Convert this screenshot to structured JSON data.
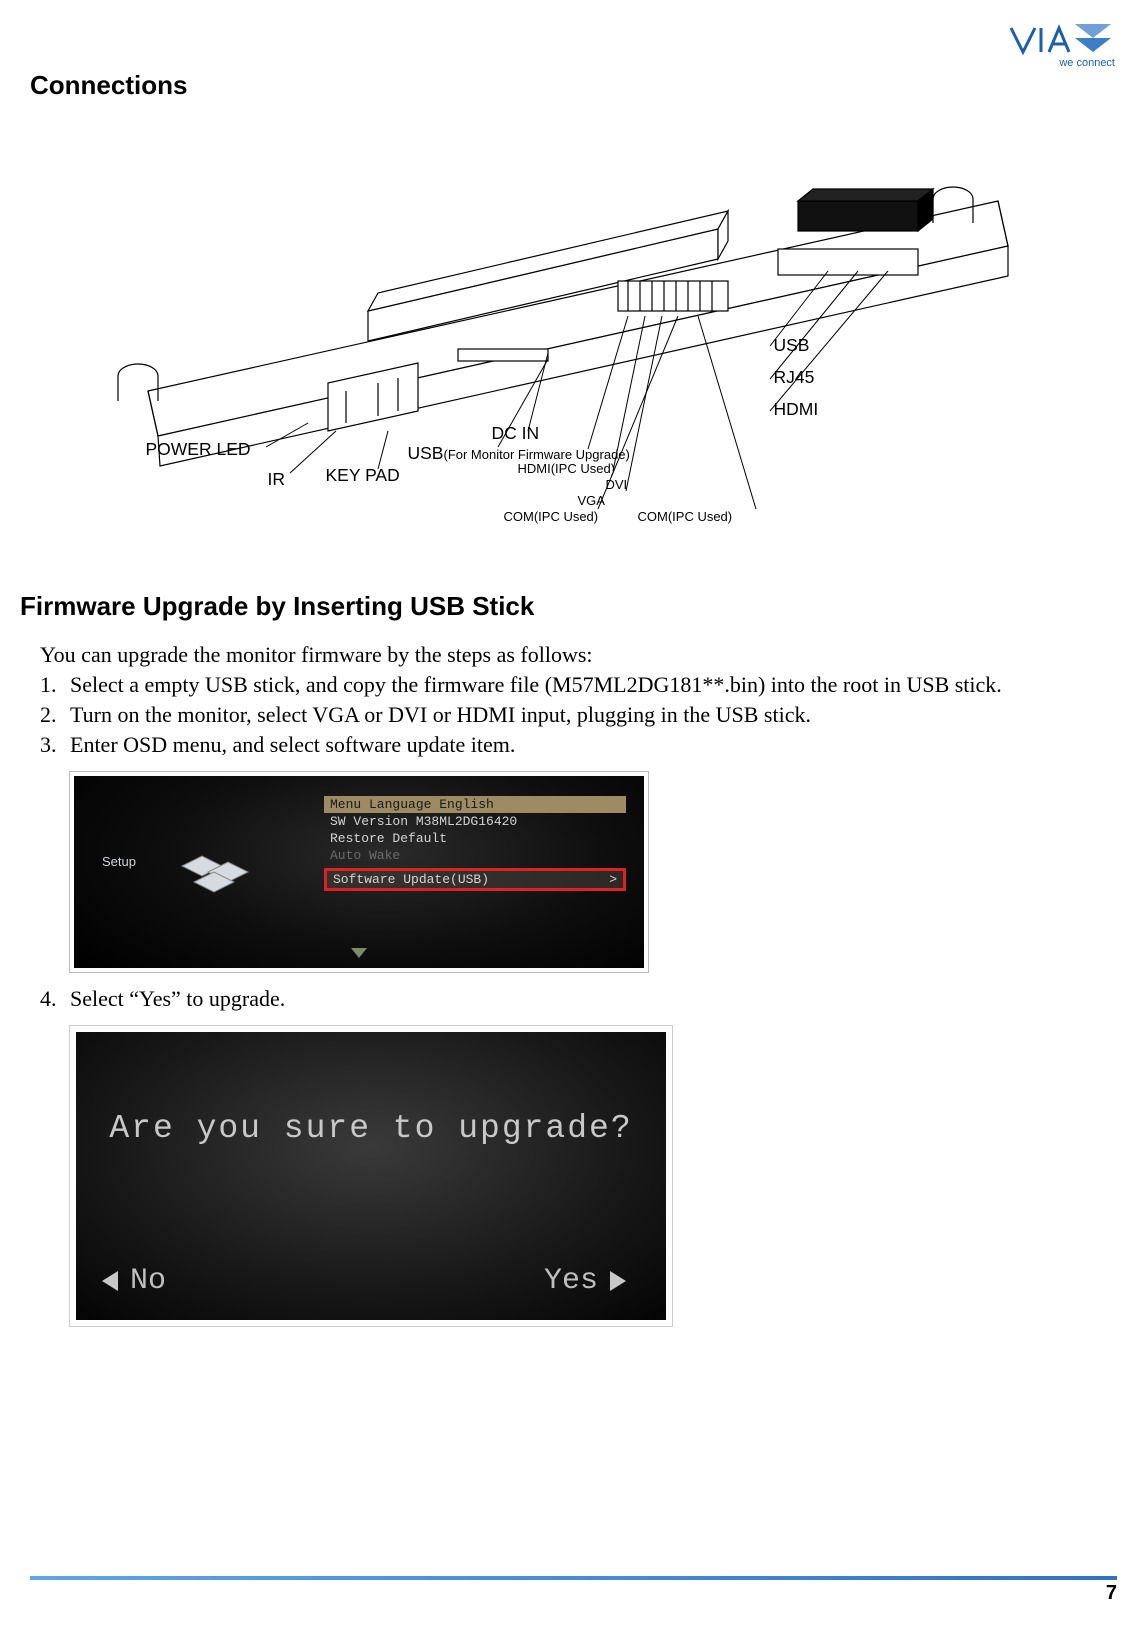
{
  "brand": {
    "name": "VIA",
    "tagline": "we connect"
  },
  "headings": {
    "connections": "Connections",
    "firmware": "Firmware Upgrade by Inserting USB Stick"
  },
  "connections_labels": {
    "power_led": "POWER LED",
    "ir": "IR",
    "key_pad": "KEY PAD",
    "dc_in": "DC IN",
    "usb_firmware": "USB",
    "usb_firmware_note": "(For Monitor Firmware Upgrade)",
    "hdmi_ipc": "HDMI(IPC Used)",
    "dvi": "DVI",
    "vga": "VGA",
    "com_ipc_left": "COM(IPC Used)",
    "com_ipc_right": "COM(IPC Used)",
    "usb": "USB",
    "rj45": "RJ45",
    "hdmi": "HDMI"
  },
  "intro": "You can upgrade the monitor firmware by the steps as follows:",
  "steps": [
    {
      "n": "1.",
      "text": "Select a empty USB stick, and copy the firmware file (M57ML2DG181**.bin) into the root in USB stick."
    },
    {
      "n": "2.",
      "text": "Turn on the monitor, select VGA or DVI or HDMI input, plugging in the USB stick."
    },
    {
      "n": "3.",
      "text": "Enter OSD menu, and select software update item."
    },
    {
      "n": "4.",
      "text": "Select “Yes” to upgrade."
    }
  ],
  "osd1": {
    "setup": "Setup",
    "menu_language": "Menu Language English",
    "sw_version": "SW Version M38ML2DG16420",
    "restore_default": "Restore Default",
    "auto_wake": "Auto Wake",
    "software_update": "Software Update(USB)"
  },
  "osd2": {
    "question": "Are you sure to upgrade?",
    "no": "No",
    "yes": "Yes"
  },
  "page_number": "7"
}
